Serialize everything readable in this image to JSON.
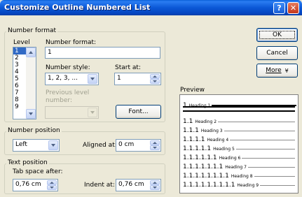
{
  "window": {
    "title": "Customize Outline Numbered List",
    "help_label": "?",
    "close_label": "✕"
  },
  "number_format": {
    "group_label": "Number format",
    "level_label": "Level",
    "levels": [
      "1",
      "2",
      "3",
      "4",
      "5",
      "6",
      "7",
      "8",
      "9"
    ],
    "selected_level": "1",
    "number_format_label": "Number format:",
    "number_format_value": "1",
    "number_style_label": "Number style:",
    "number_style_value": "1, 2, 3, ...",
    "start_at_label": "Start at:",
    "start_at_value": "1",
    "previous_level_label": "Previous level number:",
    "font_button": "Font..."
  },
  "buttons": {
    "ok": "OK",
    "cancel": "Cancel",
    "more": "More",
    "more_icon": "double-chevron-down-icon"
  },
  "number_position": {
    "group_label": "Number position",
    "alignment_value": "Left",
    "aligned_at_label": "Aligned at:",
    "aligned_at_value": "0 cm"
  },
  "text_position": {
    "group_label": "Text position",
    "tab_space_label": "Tab space after:",
    "tab_space_value": "0,76 cm",
    "indent_at_label": "Indent at:",
    "indent_at_value": "0,76 cm"
  },
  "preview": {
    "label": "Preview",
    "rows": [
      {
        "num": "1",
        "heading": "Heading 1"
      },
      {
        "num": "1.1",
        "heading": "Heading 2"
      },
      {
        "num": "1.1.1",
        "heading": "Heading 3"
      },
      {
        "num": "1.1.1.1",
        "heading": "Heading 4"
      },
      {
        "num": "1.1.1.1.1",
        "heading": "Heading 5"
      },
      {
        "num": "1.1.1.1.1.1",
        "heading": "Heading 6"
      },
      {
        "num": "1.1.1.1.1.1.1",
        "heading": "Heading 7"
      },
      {
        "num": "1.1.1.1.1.1.1.1",
        "heading": "Heading 8"
      },
      {
        "num": "1.1.1.1.1.1.1.1.1",
        "heading": "Heading 9"
      }
    ]
  }
}
